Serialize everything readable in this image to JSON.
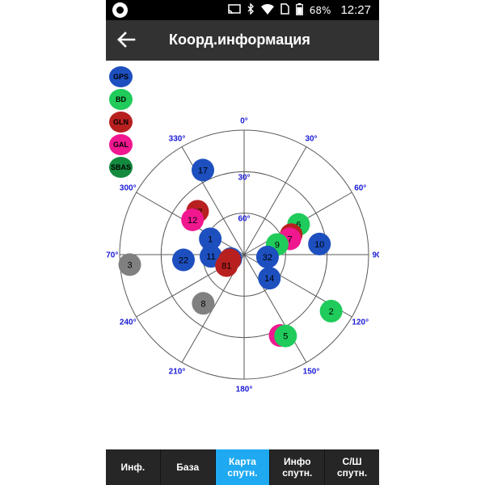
{
  "status_bar": {
    "icons": [
      "cast-icon",
      "bluetooth-icon",
      "wifi-icon",
      "sim-icon",
      "battery-icon"
    ],
    "battery": "68%",
    "time": "12:27"
  },
  "toolbar": {
    "back_icon": "arrow-left-icon",
    "title": "Коорд.информация"
  },
  "legend": [
    {
      "label": "GPS",
      "color": "#1d4fbf"
    },
    {
      "label": "BD",
      "color": "#1fcb5a"
    },
    {
      "label": "GLN",
      "color": "#b82020"
    },
    {
      "label": "GAL",
      "color": "#f0178f"
    },
    {
      "label": "SBAS",
      "color": "#138a3e"
    }
  ],
  "skyplot": {
    "azimuth_labels": [
      {
        "az": 0,
        "text": "0°"
      },
      {
        "az": 30,
        "text": "30°"
      },
      {
        "az": 60,
        "text": "60°"
      },
      {
        "az": 90,
        "text": "90°"
      },
      {
        "az": 120,
        "text": "120°"
      },
      {
        "az": 150,
        "text": "150°"
      },
      {
        "az": 180,
        "text": "180°"
      },
      {
        "az": 210,
        "text": "210°"
      },
      {
        "az": 240,
        "text": "240°"
      },
      {
        "az": 270,
        "text": "270°"
      },
      {
        "az": 300,
        "text": "300°"
      },
      {
        "az": 330,
        "text": "330°"
      }
    ],
    "elevation_labels": [
      {
        "elev": 30,
        "text": "30°"
      },
      {
        "elev": 60,
        "text": "60°"
      }
    ],
    "label_color": "#1a1ad6",
    "unknown_color": "#808080",
    "satellites": [
      {
        "id": "17",
        "system": "GPS",
        "az": 334,
        "elev": 22
      },
      {
        "id": "82",
        "system": "GLN",
        "az": 313,
        "elev": 44
      },
      {
        "id": "12",
        "system": "GAL",
        "az": 304,
        "elev": 45
      },
      {
        "id": "1",
        "system": "GPS",
        "az": 295,
        "elev": 63
      },
      {
        "id": "6",
        "system": "BD",
        "az": 61,
        "elev": 45
      },
      {
        "id": "65",
        "system": "GLN",
        "az": 67,
        "elev": 53
      },
      {
        "id": "7",
        "system": "GAL",
        "az": 71,
        "elev": 55
      },
      {
        "id": "9",
        "system": "BD",
        "az": 73,
        "elev": 65
      },
      {
        "id": "10",
        "system": "GPS",
        "az": 82,
        "elev": 35
      },
      {
        "id": "32",
        "system": "GPS",
        "az": 96,
        "elev": 73
      },
      {
        "id": "3",
        "system": "",
        "az": 265,
        "elev": 7
      },
      {
        "id": "22",
        "system": "GPS",
        "az": 265,
        "elev": 46
      },
      {
        "id": "11",
        "system": "GPS",
        "az": 267,
        "elev": 66
      },
      {
        "id": "63",
        "system": "GPS",
        "az": 253,
        "elev": 80
      },
      {
        "id": "66",
        "system": "GLN",
        "az": 250,
        "elev": 79
      },
      {
        "id": "81",
        "system": "GLN",
        "az": 238,
        "elev": 75
      },
      {
        "id": "14",
        "system": "GPS",
        "az": 133,
        "elev": 65
      },
      {
        "id": "8",
        "system": "",
        "az": 220,
        "elev": 44
      },
      {
        "id": "2",
        "system": "BD",
        "az": 123,
        "elev": 15
      },
      {
        "id": "24",
        "system": "GAL",
        "az": 156,
        "elev": 26
      },
      {
        "id": "5",
        "system": "BD",
        "az": 153,
        "elev": 24
      }
    ]
  },
  "tabs": [
    {
      "label": "Инф.",
      "active": false
    },
    {
      "label": "База",
      "active": false
    },
    {
      "label": "Карта\nспутн.",
      "active": true
    },
    {
      "label": "Инфо\nспутн.",
      "active": false
    },
    {
      "label": "С/Ш\nспутн.",
      "active": false
    }
  ]
}
